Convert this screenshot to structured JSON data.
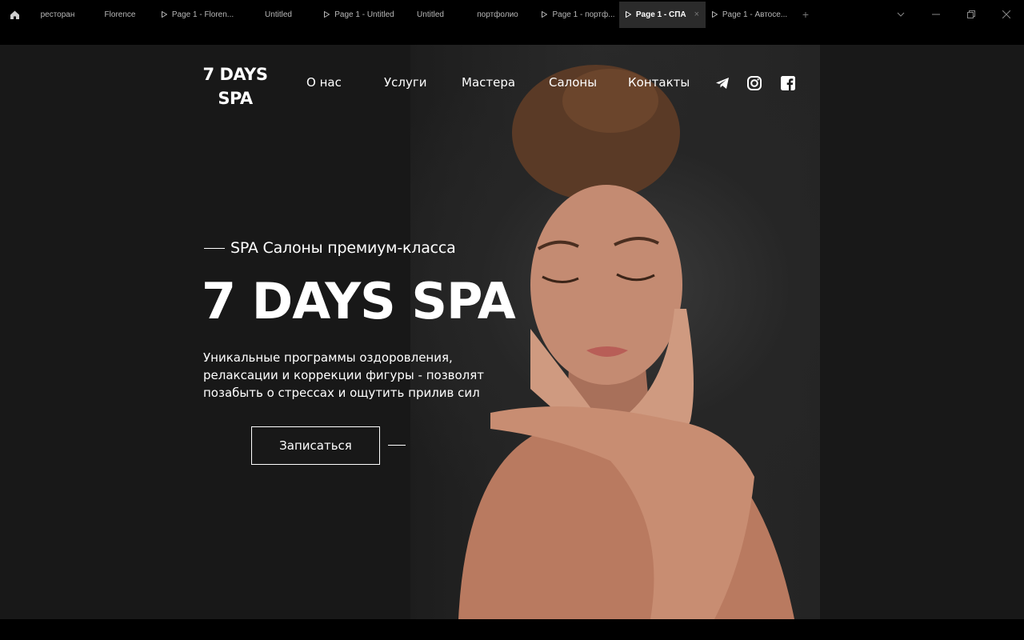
{
  "tabs": [
    {
      "label": "ресторан",
      "has_play": false,
      "active": false
    },
    {
      "label": "Florence",
      "has_play": false,
      "active": false
    },
    {
      "label": "Page 1 - Floren...",
      "has_play": true,
      "active": false
    },
    {
      "label": "Untitled",
      "has_play": false,
      "active": false
    },
    {
      "label": "Page 1 - Untitled",
      "has_play": true,
      "active": false
    },
    {
      "label": "Untitled",
      "has_play": false,
      "active": false
    },
    {
      "label": "портфолио",
      "has_play": false,
      "active": false
    },
    {
      "label": "Page 1 - портф...",
      "has_play": true,
      "active": false
    },
    {
      "label": "Page 1 - СПА",
      "has_play": true,
      "active": true
    },
    {
      "label": "Page 1 - Автосе...",
      "has_play": true,
      "active": false
    }
  ],
  "site": {
    "logo_line1": "7 DAYS",
    "logo_line2": "SPA",
    "nav": [
      "О нас",
      "Услуги",
      "Мастера",
      "Салоны",
      "Контакты"
    ],
    "social_icons": [
      "telegram-icon",
      "instagram-icon",
      "facebook-icon"
    ]
  },
  "hero": {
    "subtitle": "SPA Салоны премиум-класса",
    "title": "7 DAYS SPA",
    "description": "Уникальные программы оздоровления, релаксации и коррекции фигуры - позволят позабыть о стрессах и ощутить прилив сил",
    "cta_label": "Записаться"
  },
  "colors": {
    "page_bg": "#181818",
    "tab_active_bg": "#2b2b2b",
    "text": "#ffffff"
  }
}
